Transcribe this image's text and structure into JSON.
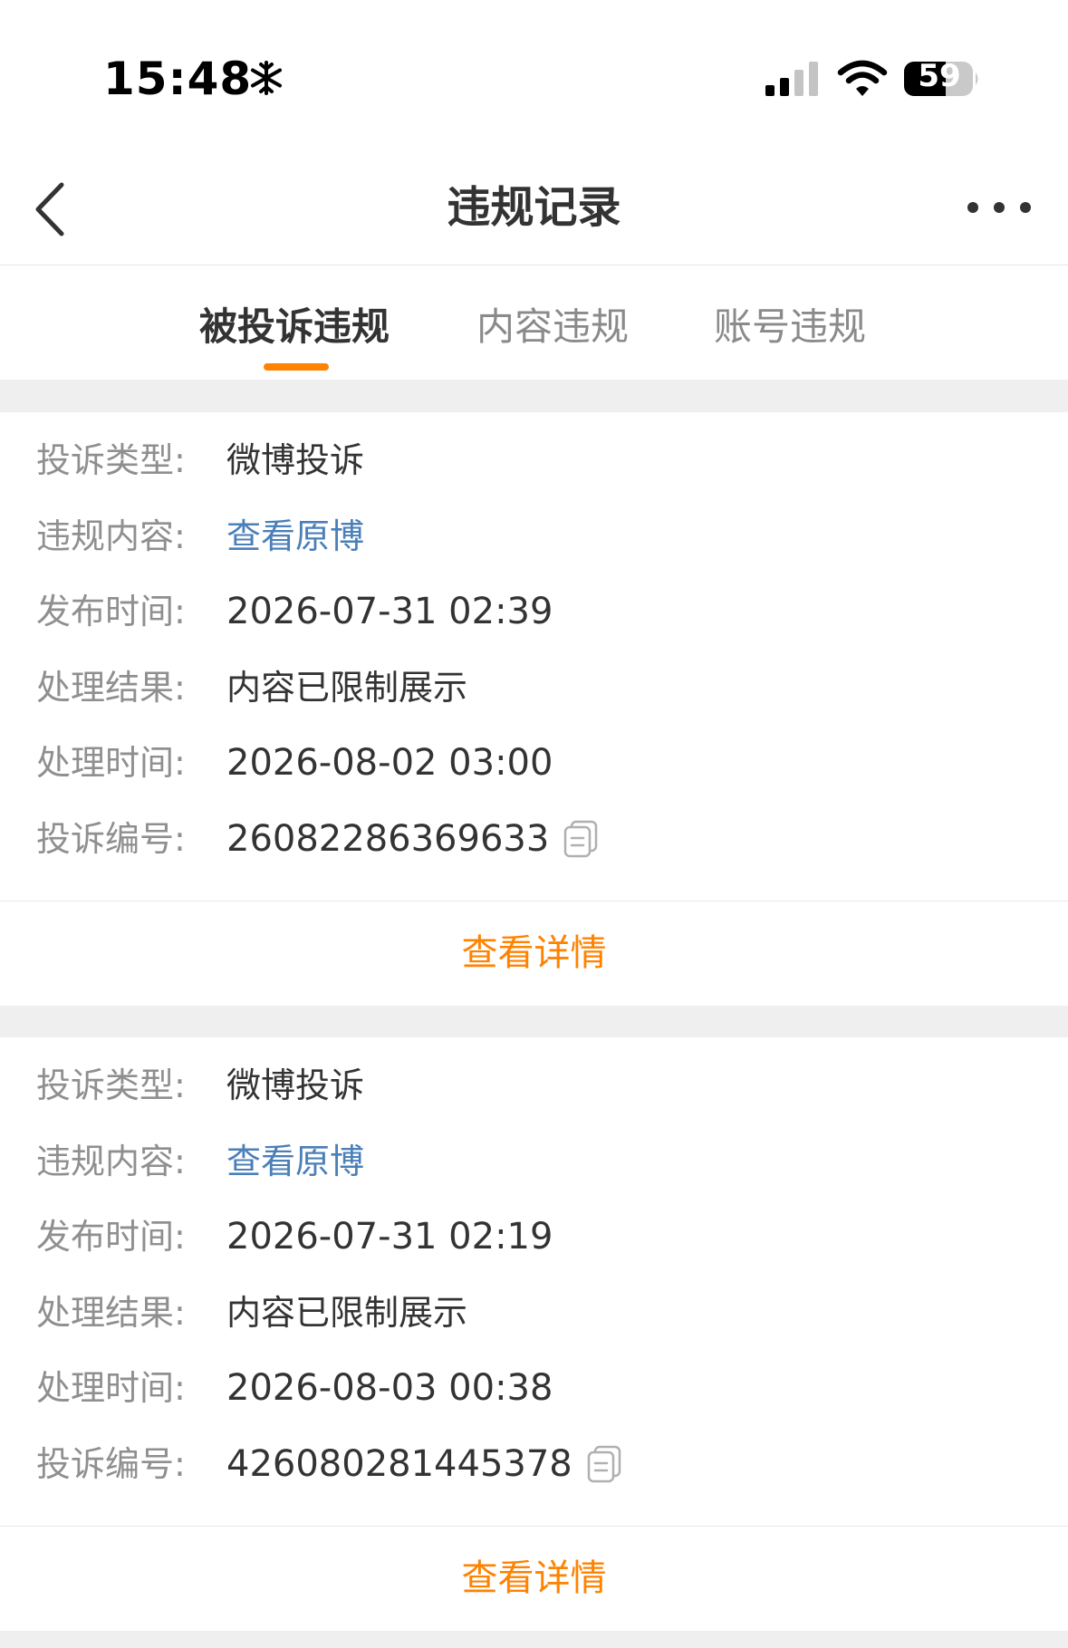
{
  "status_bar": {
    "time": "15:48",
    "battery": "59"
  },
  "nav": {
    "title": "违规记录"
  },
  "tabs": [
    {
      "label": "被投诉违规",
      "active": true
    },
    {
      "label": "内容违规",
      "active": false
    },
    {
      "label": "账号违规",
      "active": false
    }
  ],
  "records": [
    {
      "rows": [
        {
          "label": "投诉类型:",
          "value": "微博投诉"
        },
        {
          "label": "违规内容:",
          "value": "查看原博"
        },
        {
          "label": "发布时间:",
          "value": "2026-07-31 02:39"
        },
        {
          "label": "处理结果:",
          "value": "内容已限制展示"
        },
        {
          "label": "处理时间:",
          "value": "2026-08-02 03:00"
        },
        {
          "label": "投诉编号:",
          "value": "26082286369633"
        }
      ],
      "detail_label": "查看详情"
    },
    {
      "rows": [
        {
          "label": "投诉类型:",
          "value": "微博投诉"
        },
        {
          "label": "违规内容:",
          "value": "查看原博"
        },
        {
          "label": "发布时间:",
          "value": "2026-07-31 02:19"
        },
        {
          "label": "处理结果:",
          "value": "内容已限制展示"
        },
        {
          "label": "处理时间:",
          "value": "2026-08-03 00:38"
        },
        {
          "label": "投诉编号:",
          "value": "426080281445378"
        }
      ],
      "detail_label": "查看详情"
    }
  ],
  "colors": {
    "accent": "#ff8200",
    "link": "#4a7fb8",
    "label": "#8f8f8f",
    "text": "#333333",
    "background": "#efefef"
  },
  "icons": {
    "back": "chevron-left-icon",
    "more": "more-horizontal-icon",
    "copy": "copy-icon",
    "snow": "snowflake-icon",
    "signal": "cellular-signal-icon",
    "wifi": "wifi-icon",
    "battery": "battery-icon"
  }
}
